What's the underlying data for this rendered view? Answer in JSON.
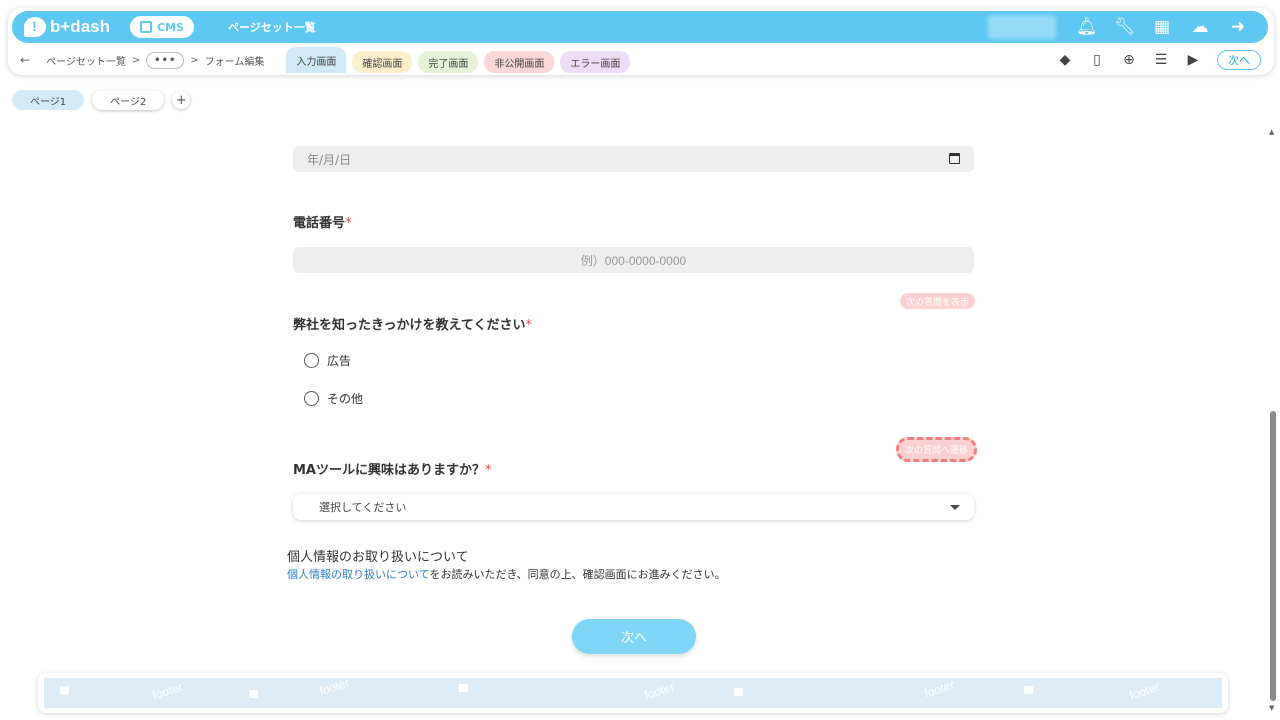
{
  "header": {
    "brand": "b+dash",
    "cms_label": "CMS",
    "title": "ページセット一覧",
    "icons": [
      "bell-icon",
      "wrench-icon",
      "grid-icon",
      "chat-icon",
      "logout-icon"
    ]
  },
  "breadcrumb": {
    "back": "←",
    "items": [
      "ページセット一覧",
      "•••",
      "フォーム編集"
    ],
    "sep": ">"
  },
  "tabs": [
    "入力画面",
    "確認画面",
    "完了画面",
    "非公開画面",
    "エラー画面"
  ],
  "toolbar": {
    "next_label": "次へ"
  },
  "pages": {
    "items": [
      "ページ1",
      "ページ2"
    ],
    "add": "+"
  },
  "form": {
    "date_placeholder": "年/月/日",
    "phone_label": "電話番号",
    "phone_placeholder": "例）000-0000-0000",
    "required_mark": "*",
    "source_label": "弊社を知ったきっかけを教えてください",
    "source_hint": "次の質問を表示",
    "options": [
      "広告",
      "その他"
    ],
    "ma_label": "MAツールに興味はありますか？",
    "ma_hint": "次の質問へ遷移",
    "select_placeholder": "選択してください",
    "privacy_title": "個人情報のお取り扱いについて",
    "privacy_link": "個人情報の取り扱いについて",
    "privacy_text": "をお読みいただき、同意の上、確認画面にお進みください。",
    "submit_label": "次へ"
  },
  "footer": {
    "watermark": "footer"
  }
}
